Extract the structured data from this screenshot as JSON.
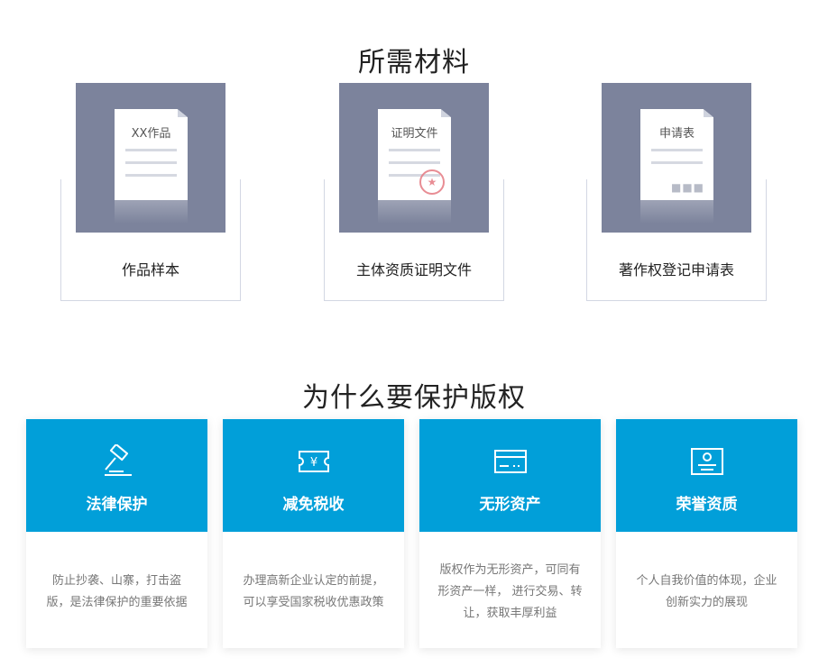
{
  "materials": {
    "title": "所需材料",
    "items": [
      {
        "doc_title": "XX作品",
        "caption": "作品样本"
      },
      {
        "doc_title": "证明文件",
        "caption": "主体资质证明文件",
        "stamp": "★"
      },
      {
        "doc_title": "申请表",
        "caption": "著作权登记申请表",
        "dots": "■■■"
      }
    ]
  },
  "why": {
    "title": "为什么要保护版权",
    "items": [
      {
        "icon": "gavel-icon",
        "title": "法律保护",
        "desc": "防止抄袭、山寨，打击盗版，是法律保护的重要依据"
      },
      {
        "icon": "yen-ticket-icon",
        "title": "减免税收",
        "desc": "办理高新企业认定的前提，可以享受国家税收优惠政策"
      },
      {
        "icon": "card-icon",
        "title": "无形资产",
        "desc": "版权作为无形资产，可同有形资产一样， 进行交易、转让，获取丰厚利益"
      },
      {
        "icon": "certificate-icon",
        "title": "荣誉资质",
        "desc": "个人自我价值的体现，企业创新实力的展现"
      }
    ]
  },
  "colors": {
    "accent_blue": "#019fd9",
    "panel_gray": "#7c839c",
    "flap_navy": "#4a527a",
    "stamp_red": "#e57a82"
  }
}
